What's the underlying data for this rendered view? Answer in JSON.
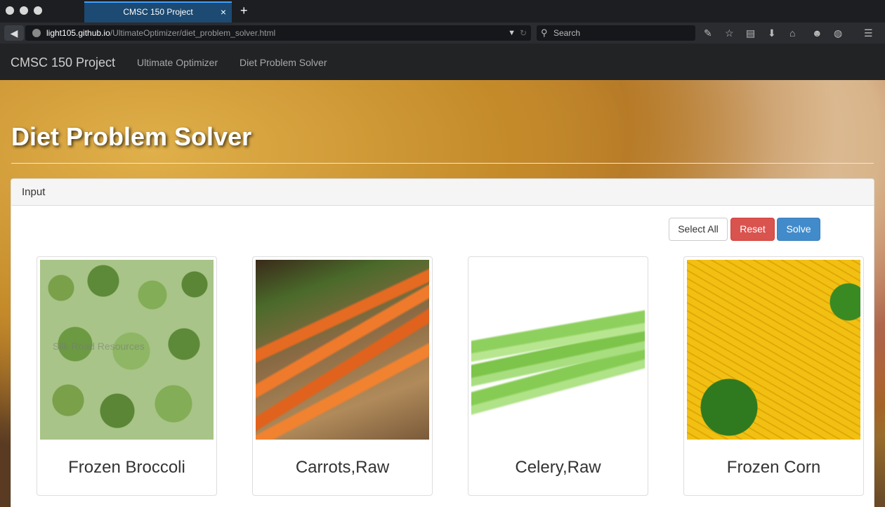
{
  "browser": {
    "tab_title": "CMSC 150 Project",
    "tab_close": "×",
    "new_tab": "+",
    "url_host": "light105.github.io",
    "url_path": "/UltimateOptimizer/diet_problem_solver.html",
    "search_placeholder": "Search"
  },
  "site": {
    "brand": "CMSC 150 Project",
    "nav_links": [
      "Ultimate Optimizer",
      "Diet Problem Solver"
    ]
  },
  "hero": {
    "title": "Diet Problem Solver"
  },
  "panel": {
    "heading": "Input",
    "buttons": {
      "select_all": "Select All",
      "reset": "Reset",
      "solve": "Solve"
    },
    "foods": [
      {
        "name": "Frozen Broccoli",
        "image_watermark": "Silk Road Resources"
      },
      {
        "name": "Carrots,Raw"
      },
      {
        "name": "Celery,Raw"
      },
      {
        "name": "Frozen Corn"
      }
    ]
  }
}
